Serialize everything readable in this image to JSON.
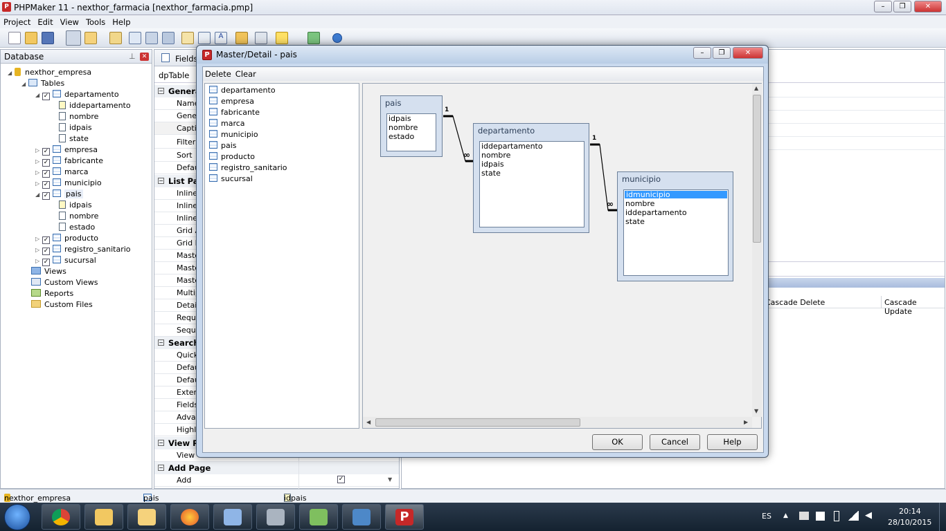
{
  "app": {
    "title": "PHPMaker 11 - nexthor_farmacia [nexthor_farmacia.pmp]",
    "menu": [
      "Project",
      "Edit",
      "View",
      "Tools",
      "Help"
    ]
  },
  "database_panel": {
    "title": "Database",
    "tree": {
      "root": "nexthor_empresa",
      "tables_label": "Tables",
      "tables": [
        {
          "name": "departamento",
          "expanded": true,
          "fields": [
            "iddepartamento",
            "nombre",
            "idpais",
            "state"
          ]
        },
        {
          "name": "empresa"
        },
        {
          "name": "fabricante"
        },
        {
          "name": "marca"
        },
        {
          "name": "municipio"
        },
        {
          "name": "pais",
          "expanded": true,
          "fields": [
            "idpais",
            "nombre",
            "estado"
          ]
        },
        {
          "name": "producto"
        },
        {
          "name": "registro_sanitario"
        },
        {
          "name": "sucursal"
        }
      ],
      "views_label": "Views",
      "custom_views_label": "Custom Views",
      "reports_label": "Reports",
      "custom_files_label": "Custom Files"
    }
  },
  "properties": {
    "tab": "Fields",
    "table_label": "dpTable",
    "sections": [
      {
        "title": "Genera",
        "rows": [
          "Name",
          "Gener",
          "Captio",
          "Filter",
          "Sort",
          "Defau"
        ]
      },
      {
        "title": "List Pag",
        "rows": [
          "Inline",
          "Inline",
          "Inline",
          "Grid A",
          "Grid E",
          "Maste",
          "Maste",
          "Maste",
          "Multip",
          "Detail",
          "Requi",
          "Seque"
        ]
      },
      {
        "title": "Search",
        "rows": [
          "Quick",
          "Defau",
          "Defau",
          "Exten",
          "Fields",
          "Advan",
          "Highli"
        ]
      },
      {
        "title": "View Pa",
        "rows": [
          "View"
        ]
      },
      {
        "title": "Add Page",
        "rows": [
          "Add"
        ]
      }
    ]
  },
  "relations_header": {
    "cascade_delete": "Cascade Delete",
    "cascade_update": "Cascade Update"
  },
  "dialog": {
    "title": "Master/Detail - pais",
    "menu": [
      "Delete",
      "Clear"
    ],
    "table_list": [
      "departamento",
      "empresa",
      "fabricante",
      "marca",
      "municipio",
      "pais",
      "producto",
      "registro_sanitario",
      "sucursal"
    ],
    "entities": [
      {
        "name": "pais",
        "fields": [
          "idpais",
          "nombre",
          "estado"
        ]
      },
      {
        "name": "departamento",
        "fields": [
          "iddepartamento",
          "nombre",
          "idpais",
          "state"
        ]
      },
      {
        "name": "municipio",
        "fields": [
          "idmunicipio",
          "nombre",
          "iddepartamento",
          "state"
        ],
        "selected_field": "idmunicipio"
      }
    ],
    "cardinality": {
      "one": "1",
      "many": "∞"
    },
    "buttons": {
      "ok": "OK",
      "cancel": "Cancel",
      "help": "Help"
    }
  },
  "bottom_tabs": [
    "nexthor_empresa",
    "pais",
    "idpais"
  ],
  "taskbar": {
    "language": "ES",
    "time": "20:14",
    "date": "28/10/2015"
  }
}
